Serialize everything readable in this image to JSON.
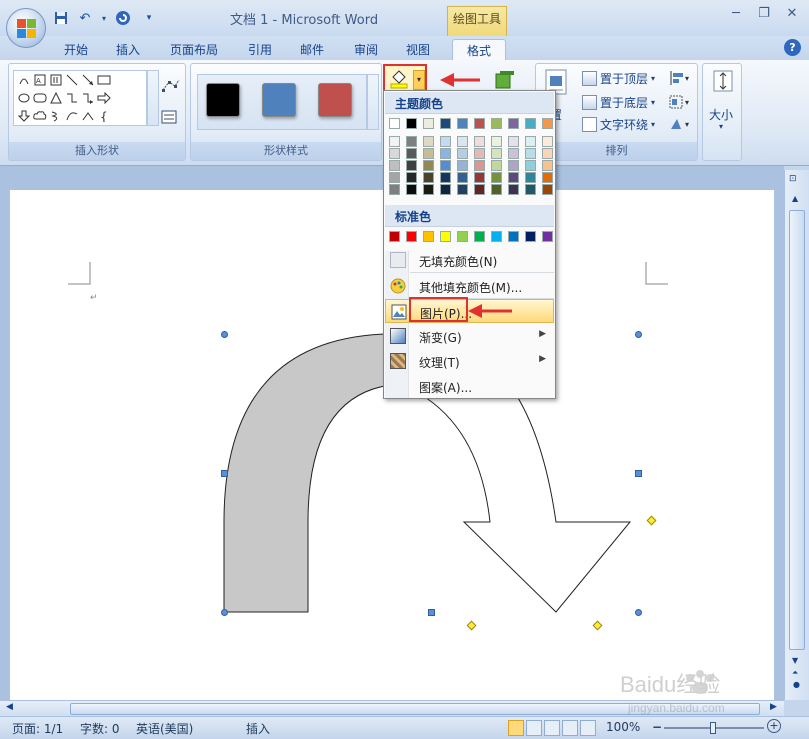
{
  "window": {
    "title": "文档 1 - Microsoft Word",
    "context_tab_title": "绘图工具"
  },
  "tabs": [
    {
      "label": "开始"
    },
    {
      "label": "插入"
    },
    {
      "label": "页面布局"
    },
    {
      "label": "引用"
    },
    {
      "label": "邮件"
    },
    {
      "label": "审阅"
    },
    {
      "label": "视图"
    },
    {
      "label": "格式"
    }
  ],
  "ribbon": {
    "groups": {
      "insert_shapes": "插入形状",
      "shape_styles": "形状样式",
      "arrange": "排列",
      "size": "大小"
    },
    "style_swatches": [
      "#000000",
      "#4f81bd",
      "#c0504d"
    ],
    "arrange_items": {
      "bring_to_front": "置于顶层",
      "send_to_back": "置于底层",
      "text_wrap": "文字环绕",
      "position_partial": "置"
    }
  },
  "fill_menu": {
    "theme_colors_header": "主题颜色",
    "standard_colors_header": "标准色",
    "theme_top_row": [
      "#ffffff",
      "#000000",
      "#eeece1",
      "#1f497d",
      "#4f81bd",
      "#c0504d",
      "#9bbb59",
      "#8064a2",
      "#4bacc6",
      "#f79646"
    ],
    "theme_shades": [
      [
        "#f2f2f2",
        "#7f7f7f",
        "#ddd9c3",
        "#c6d9f0",
        "#dbe5f1",
        "#f2dcdb",
        "#ebf1dd",
        "#e5e0ec",
        "#dbeef3",
        "#fdeada"
      ],
      [
        "#d8d8d8",
        "#595959",
        "#c4bd97",
        "#8db3e2",
        "#b8cce4",
        "#e5b9b7",
        "#d7e3bc",
        "#ccc1d9",
        "#b7dde8",
        "#fbd5b5"
      ],
      [
        "#bfbfbf",
        "#3f3f3f",
        "#938953",
        "#548dd4",
        "#95b3d7",
        "#d99694",
        "#c3d69b",
        "#b2a2c7",
        "#92cddc",
        "#fac08f"
      ],
      [
        "#a5a5a5",
        "#262626",
        "#494429",
        "#17365d",
        "#366092",
        "#953734",
        "#76923c",
        "#5f497a",
        "#31859b",
        "#e36c09"
      ],
      [
        "#7f7f7f",
        "#0c0c0c",
        "#1d1b10",
        "#0f243e",
        "#244061",
        "#632423",
        "#4f6128",
        "#3f3151",
        "#205867",
        "#974806"
      ]
    ],
    "standard_colors": [
      "#c00000",
      "#ff0000",
      "#ffc000",
      "#ffff00",
      "#92d050",
      "#00b050",
      "#00b0f0",
      "#0070c0",
      "#002060",
      "#7030a0"
    ],
    "items": {
      "no_fill": "无填充颜色(N)",
      "more_colors": "其他填充颜色(M)...",
      "picture": "图片(P)...",
      "gradient": "渐变(G)",
      "texture": "纹理(T)",
      "pattern": "图案(A)..."
    }
  },
  "statusbar": {
    "page": "页面: 1/1",
    "words": "字数: 0",
    "language": "英语(美国)",
    "mode": "插入",
    "zoom": "100%"
  },
  "watermark": {
    "brand": "Baidu经验",
    "url": "jingyan.baidu.com"
  }
}
